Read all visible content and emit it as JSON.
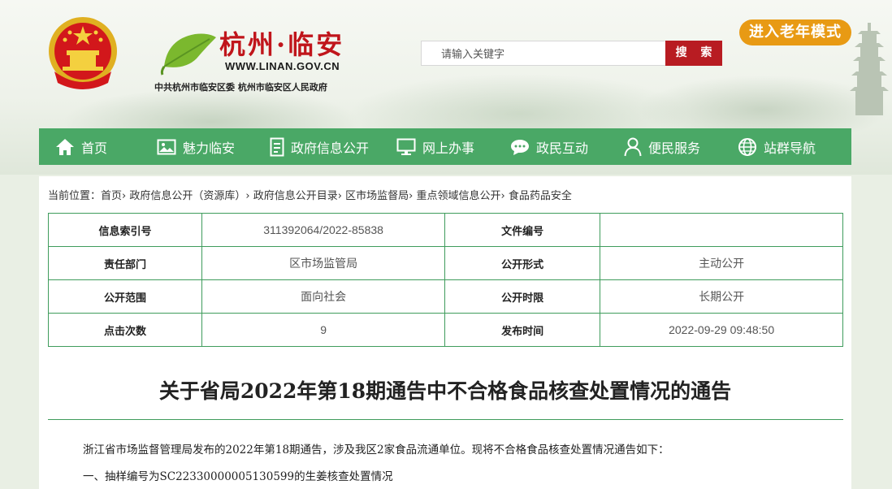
{
  "header": {
    "logo_text": "杭州·临安",
    "logo_url": "WWW.LINAN.GOV.CN",
    "org_line": "中共杭州市临安区委  杭州市临安区人民政府",
    "search_placeholder": "请输入关键字",
    "search_button": "搜 索",
    "elder_mode": "进入老年模式"
  },
  "nav": {
    "items": [
      {
        "label": "首页",
        "icon": "home-icon"
      },
      {
        "label": "魅力临安",
        "icon": "image-icon"
      },
      {
        "label": "政府信息公开",
        "icon": "document-icon"
      },
      {
        "label": "网上办事",
        "icon": "monitor-icon"
      },
      {
        "label": "政民互动",
        "icon": "chat-icon"
      },
      {
        "label": "便民服务",
        "icon": "user-icon"
      },
      {
        "label": "站群导航",
        "icon": "globe-icon"
      }
    ]
  },
  "breadcrumb": {
    "prefix": "当前位置：",
    "items": [
      "首页",
      "政府信息公开（资源库）",
      "政府信息公开目录",
      "区市场监督局",
      "重点领域信息公开",
      "食品药品安全"
    ],
    "sep": "›"
  },
  "meta": {
    "rows": [
      {
        "k1": "信息索引号",
        "v1": "311392064/2022-85838",
        "k2": "文件编号",
        "v2": ""
      },
      {
        "k1": "责任部门",
        "v1": "区市场监管局",
        "k2": "公开形式",
        "v2": "主动公开"
      },
      {
        "k1": "公开范围",
        "v1": "面向社会",
        "k2": "公开时限",
        "v2": "长期公开"
      },
      {
        "k1": "点击次数",
        "v1": "9",
        "k2": "发布时间",
        "v2": "2022-09-29 09:48:50"
      }
    ]
  },
  "article": {
    "title": "关于省局2022年第18期通告中不合格食品核查处置情况的通告",
    "paragraphs": [
      "浙江省市场监督管理局发布的2022年第18期通告，涉及我区2家食品流通单位。现将不合格食品核查处置情况通告如下：",
      "一、抽样编号为SC22330000005130599的生姜核查处置情况"
    ]
  },
  "colors": {
    "nav_green": "#4aa866",
    "search_red": "#b81c22",
    "elder_orange": "#e89a14",
    "border_green": "#3f9c5c",
    "logo_red": "#c0151b"
  }
}
